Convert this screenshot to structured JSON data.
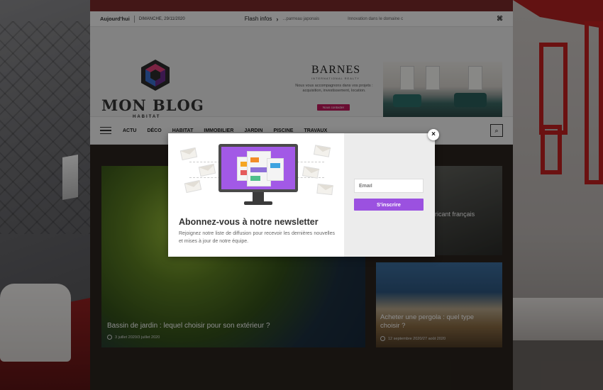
{
  "topbar": {
    "today_label": "Aujourd'hui",
    "date": "DIMANCHE, 29/11/2020",
    "flash_label": "Flash infos",
    "ticker": [
      "...parrreau japonais",
      "Innovation dans le domaine c"
    ],
    "rss_icon": "rss-icon"
  },
  "logo": {
    "title": "MON BLOG",
    "subtitle": "HABITAT"
  },
  "ad": {
    "brand": "BARNES",
    "brand_sub": "INTERNATIONAL REALTY",
    "text": "Nous vous accompagnons dans vos projets : acquisition, investissement, location.",
    "button": "Nous contacter"
  },
  "nav": {
    "items": [
      "ACTU",
      "DÉCO",
      "HABITAT",
      "IMMOBILIER",
      "JARDIN",
      "PISCINE",
      "TRAVAUX"
    ]
  },
  "cards": [
    {
      "title": "Bassin de jardin : lequel choisir pour son extérieur ?",
      "meta": "3 juillet 2020/3 juillet 2020"
    },
    {
      "title": "Acheter une pergola : quel type choisir ?",
      "meta": "12 septembre 2020/27 août 2020"
    },
    {
      "title": "...le domaine du ...bricant français",
      "meta": ""
    }
  ],
  "newsletter": {
    "title": "Abonnez-vous à notre newsletter",
    "description": "Rejoignez notre liste de diffusion pour recevoir les dernières nouvelles et mises à jour de notre équipe.",
    "email_placeholder": "Email",
    "subscribe_label": "S'inscrire",
    "close_label": "×"
  },
  "colors": {
    "accent_purple": "#9b51e0",
    "ad_button": "#c2185b",
    "room_red": "#c4201f"
  }
}
